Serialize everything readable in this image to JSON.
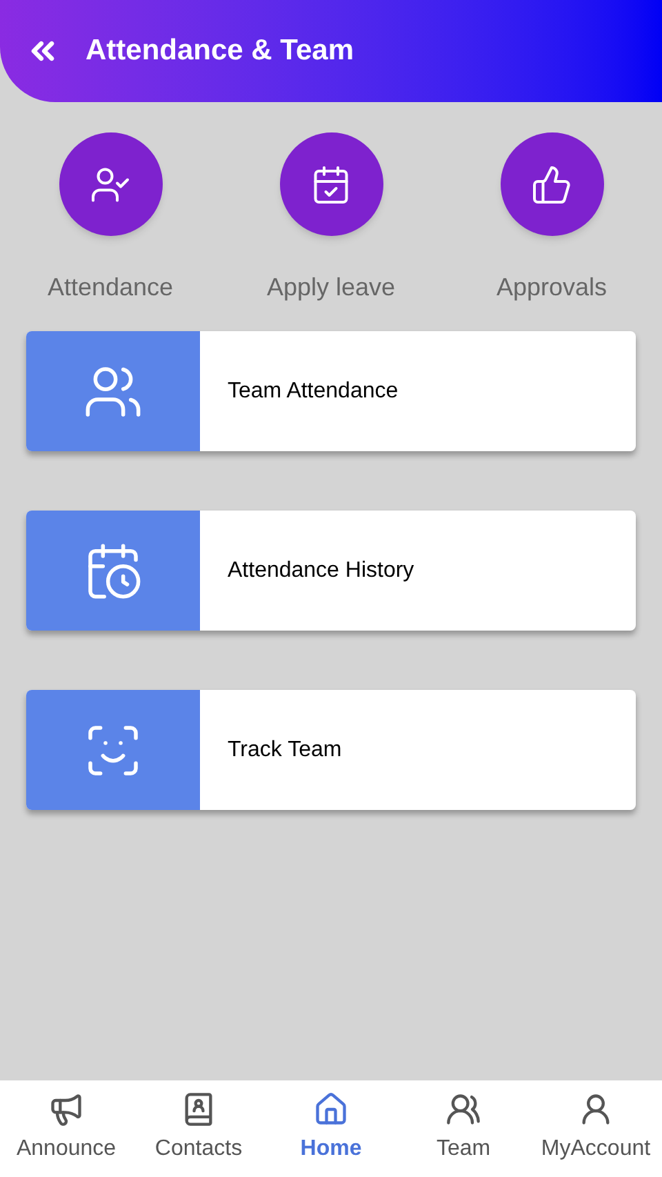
{
  "header": {
    "title": "Attendance & Team"
  },
  "shortcuts": [
    {
      "label": "Attendance"
    },
    {
      "label": "Apply leave"
    },
    {
      "label": "Approvals"
    }
  ],
  "cards": [
    {
      "label": "Team Attendance"
    },
    {
      "label": "Attendance History"
    },
    {
      "label": "Track Team"
    }
  ],
  "bottom_nav": [
    {
      "label": "Announce",
      "selected": false
    },
    {
      "label": "Contacts",
      "selected": false
    },
    {
      "label": "Home",
      "selected": true
    },
    {
      "label": "Team",
      "selected": false
    },
    {
      "label": "MyAccount",
      "selected": false
    }
  ]
}
